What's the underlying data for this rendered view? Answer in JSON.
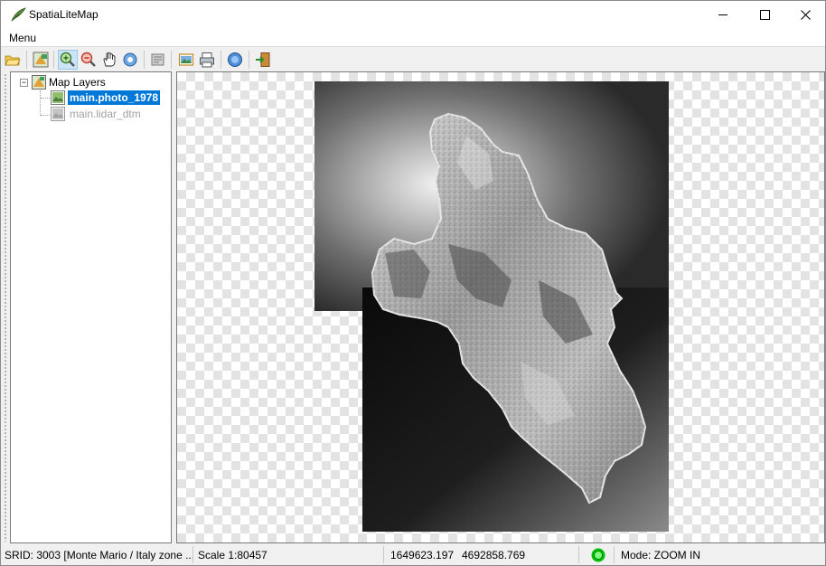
{
  "window": {
    "title": "SpatiaLiteMap",
    "icon": "feather-app-icon"
  },
  "menu": {
    "label": "Menu"
  },
  "toolbar": {
    "buttons": [
      {
        "name": "open-folder-icon",
        "active": false
      },
      {
        "name": "layers-icon",
        "active": false
      },
      {
        "name": "zoom-in-icon",
        "active": true
      },
      {
        "name": "zoom-out-icon",
        "active": false
      },
      {
        "name": "pan-hand-icon",
        "active": false
      },
      {
        "name": "identify-icon",
        "active": false
      },
      {
        "name": "properties-icon",
        "active": false
      },
      {
        "name": "export-image-icon",
        "active": false
      },
      {
        "name": "print-icon",
        "active": false
      },
      {
        "name": "about-icon",
        "active": false
      },
      {
        "name": "exit-icon",
        "active": false
      }
    ]
  },
  "tree": {
    "root_label": "Map Layers",
    "layers": [
      {
        "label": "main.photo_1978",
        "selected": true,
        "visible": true
      },
      {
        "label": "main.lidar_dtm",
        "selected": false,
        "visible": false
      }
    ]
  },
  "status": {
    "srid": "SRID: 3003 [Monte Mario / Italy zone ...",
    "scale": "Scale 1:80457",
    "x": "1649623.197",
    "y": "4692858.769",
    "indicator_color": "#00c000",
    "mode": "Mode: ZOOM IN"
  }
}
